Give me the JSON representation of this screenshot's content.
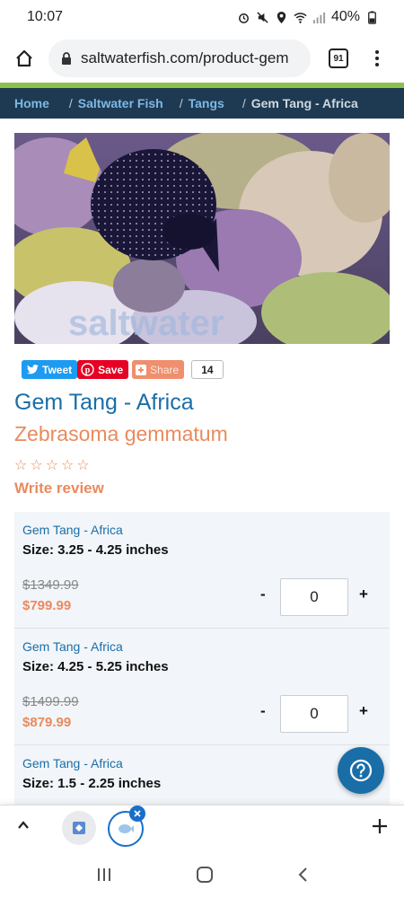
{
  "status_bar": {
    "time": "10:07",
    "battery": "40%"
  },
  "browser": {
    "url": "saltwaterfish.com/product-gem",
    "tab_count": "91"
  },
  "breadcrumb": {
    "home": "Home",
    "sep": "/",
    "category": "Saltwater Fish",
    "subcategory": "Tangs",
    "current": "Gem Tang - Africa"
  },
  "image": {
    "watermark": "saltwater"
  },
  "share": {
    "tweet": "Tweet",
    "save": "Save",
    "share": "Share",
    "count": "14"
  },
  "product": {
    "title": "Gem Tang - Africa",
    "scientific_name": "Zebrasoma gemmatum",
    "rating_stars": 0,
    "write_review": "Write review"
  },
  "variants": [
    {
      "name": "Gem Tang - Africa",
      "size": "Size: 3.25 - 4.25 inches",
      "old_price": "$1349.99",
      "price": "$799.99",
      "quantity": "0"
    },
    {
      "name": "Gem Tang - Africa",
      "size": "Size: 4.25 - 5.25 inches",
      "old_price": "$1499.99",
      "price": "$879.99",
      "quantity": "0"
    },
    {
      "name": "Gem Tang - Africa",
      "size": "Size: 1.5 - 2.25 inches"
    }
  ],
  "qty_controls": {
    "minus": "-",
    "plus": "+"
  },
  "icons": {
    "home": "home-icon",
    "lock": "lock-icon",
    "menu": "more-vert-icon",
    "help": "help-icon",
    "plus": "plus-icon",
    "chevron": "chevron-up-icon",
    "nav_recents": "recents-icon",
    "nav_home": "nav-home-icon",
    "nav_back": "back-icon"
  },
  "colors": {
    "brand_blue": "#1a6ea8",
    "accent_orange": "#ea8a5c",
    "breadcrumb_bg": "#1e3a52",
    "green_accent": "#8bc34a"
  }
}
